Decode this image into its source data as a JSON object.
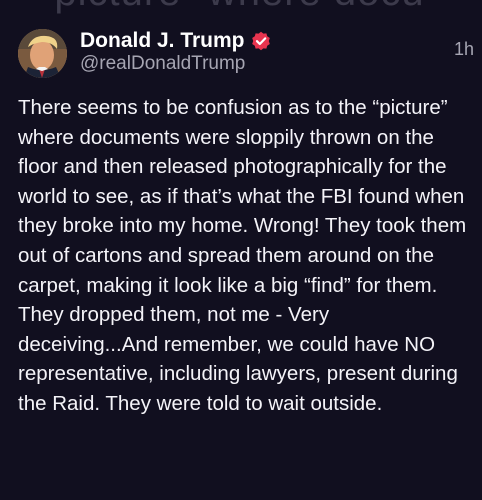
{
  "background_overlay_text": "“picture” where docu",
  "post": {
    "author": {
      "display_name": "Donald J. Trump",
      "handle": "@realDonaldTrump",
      "verified": true
    },
    "timestamp": "1h",
    "body": "There seems to be confusion as to the “picture” where documents were sloppily thrown on the floor and then released photographically for the world to see, as if that’s what the FBI found when they broke into my home. Wrong! They took them out of cartons and spread them around on the carpet, making it look like a big “find” for them. They dropped them, not me - Very deceiving...And remember, we could have NO representative, including lawyers, present during the Raid. They were told to wait outside."
  },
  "colors": {
    "background": "#110f1f",
    "text_primary": "#f4f3f8",
    "text_secondary": "#a6a5b2",
    "verified_badge": "#e8344f"
  },
  "icons": {
    "verified": "verified-badge-icon"
  }
}
